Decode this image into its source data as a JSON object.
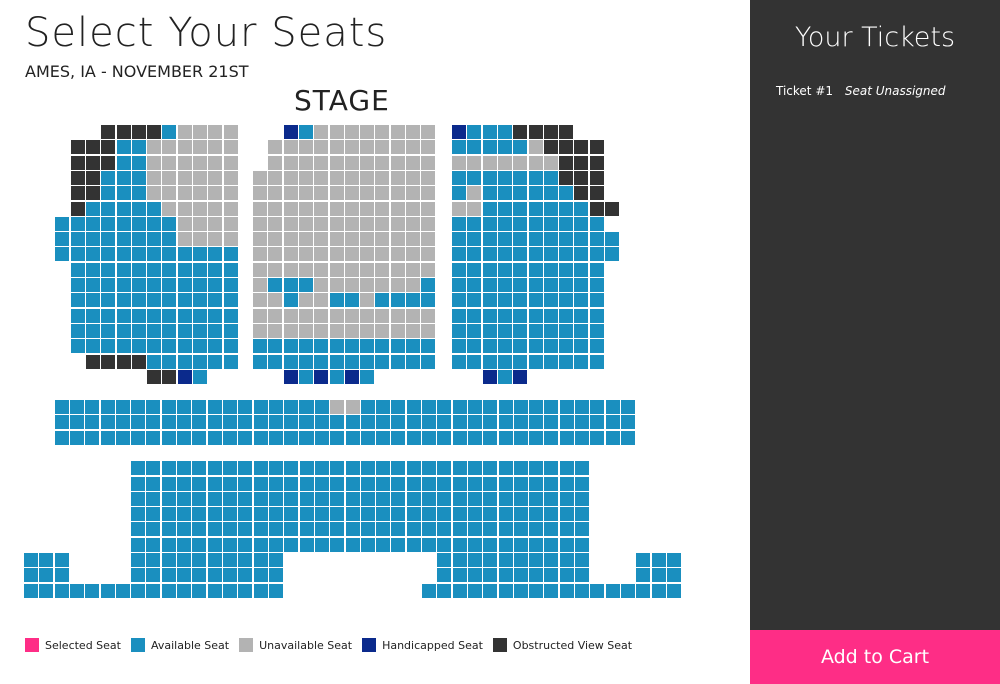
{
  "header": {
    "title": "Select Your Seats",
    "subtitle": "AMES, IA - NOVEMBER 21ST",
    "stage_label": "STAGE"
  },
  "colors": {
    "available": "#1a8fbf",
    "unavailable": "#b3b3b3",
    "handicapped": "#0b2a8c",
    "obstructed": "#333333",
    "selected": "#fe2d86"
  },
  "legend": [
    {
      "label": "Selected Seat",
      "status": "selected"
    },
    {
      "label": "Available Seat",
      "status": "available"
    },
    {
      "label": "Unavailable Seat",
      "status": "unavailable"
    },
    {
      "label": "Handicapped Seat",
      "status": "handicapped"
    },
    {
      "label": "Obstructed View Seat",
      "status": "obstructed"
    }
  ],
  "seat_sections": [
    {
      "name": "upper-left",
      "rows": [
        "....OOOOA5555",
        "..OOOAA555555",
        "..OOOAA555555",
        "..OOAAA555555",
        "..OOAAA555555",
        "..OAAAAA55555",
        ".AAAAAAAA5555",
        ".AAAAAAAA5555",
        ".AAAAAAAAAAAA",
        "..AAAAAAAAAAA",
        "..AAAAAAAAAAA",
        "..AAAAAAAAAAA",
        "..AAAAAAAAAAA",
        "..AAAAAAAAAAA",
        "..AAAAAAAAAAA",
        "...OOOOAAAAAA",
        ".......OOHA.."
      ]
    },
    {
      "name": "upper-center",
      "rows": [
        "..HA55555555",
        ".55555555555",
        ".55555555555",
        "555555555555",
        "555555555555",
        "555555555555",
        "555555555555",
        "555555555555",
        "555555555555",
        "555555555555",
        "5AAA5555555A",
        "55A55AA5AAAA",
        "555555555555",
        "555555555555",
        "AAAAAAAAAAAA",
        "AAAAAAAAAAAA",
        "..HAHAHA...."
      ]
    },
    {
      "name": "upper-right",
      "rows": [
        "HAAAOOOO...",
        "AAAAA5OOOO.",
        "5555555OOO.",
        "AAAAAAAOOO.",
        "A5AAAAAAOO.",
        "55AAAAAAAOO",
        "AAAAAAAAAA.",
        "AAAAAAAAAAA",
        "AAAAAAAAAAA",
        "AAAAAAAAAA.",
        "AAAAAAAAAA.",
        "AAAAAAAAAA.",
        "AAAAAAAAAA.",
        "AAAAAAAAAA.",
        "AAAAAAAAAA.",
        "AAAAAAAAAA.",
        "..HAH......"
      ]
    },
    {
      "name": "lower-left",
      "rows": [
        "..AAAAAAAAAAAAAAAAA....",
        "..AAAAAAAAAAAAAAAAA....",
        "..AAAAAAAAAAAAAAAAA....",
        "........................",
        ".......AAAAAAAAAA......",
        ".......AAAAAAAAAA......",
        ".......AAAAAAAAAA......",
        ".......AAAAAAAAAA......",
        ".......AAAAAAAAAA......",
        ".......AAAAAAAAAA......",
        "AAA....AAAAAAAAAA......",
        "AAA....AAAAAAAAAA......",
        "AAAAAAAAAAAAAAAAA......"
      ]
    }
  ],
  "sidebar": {
    "title": "Your Tickets",
    "ticket_number": "Ticket #1",
    "ticket_value": "Seat Unassigned",
    "cart_label": "Add to Cart"
  }
}
